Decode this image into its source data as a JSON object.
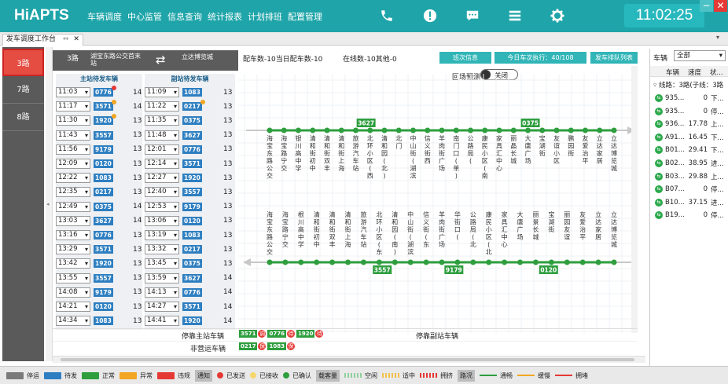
{
  "header": {
    "logo": "HiAPTS",
    "menu": [
      "车辆调度",
      "中心监管",
      "信息查询",
      "统计报表",
      "计划排班",
      "配置管理"
    ],
    "clock": "11:02:25"
  },
  "tabs": [
    {
      "label": "发车调度工作台"
    }
  ],
  "routes": [
    {
      "label": "3路",
      "selected": true
    },
    {
      "label": "7路"
    },
    {
      "label": "8路"
    }
  ],
  "route_header": {
    "name": "3路",
    "from": "湖宝东路公交首末站",
    "to": "立达博览城"
  },
  "terminals": {
    "main_title": "主站待发车辆",
    "sub_title": "副站待发车辆",
    "main_rows": [
      {
        "time": "11:03",
        "bus": "0776",
        "count": "14",
        "dot": "red"
      },
      {
        "time": "11:17",
        "bus": "3571",
        "count": "14",
        "dot": "orange"
      },
      {
        "time": "11:30",
        "bus": "1920",
        "count": "13",
        "dot": "orange"
      },
      {
        "time": "11:43",
        "bus": "3557",
        "count": "13"
      },
      {
        "time": "11:56",
        "bus": "9179",
        "count": "13"
      },
      {
        "time": "12:09",
        "bus": "0120",
        "count": "13"
      },
      {
        "time": "12:22",
        "bus": "1083",
        "count": "13"
      },
      {
        "time": "12:35",
        "bus": "0217",
        "count": "13"
      },
      {
        "time": "12:49",
        "bus": "0375",
        "count": "14"
      },
      {
        "time": "13:03",
        "bus": "3627",
        "count": "14"
      },
      {
        "time": "13:16",
        "bus": "0776",
        "count": "13"
      },
      {
        "time": "13:29",
        "bus": "3571",
        "count": "13"
      },
      {
        "time": "13:42",
        "bus": "1920",
        "count": "13"
      },
      {
        "time": "13:55",
        "bus": "3557",
        "count": "13"
      },
      {
        "time": "14:08",
        "bus": "9179",
        "count": "13"
      },
      {
        "time": "14:21",
        "bus": "0120",
        "count": "13"
      },
      {
        "time": "14:34",
        "bus": "1083",
        "count": "13"
      }
    ],
    "sub_rows": [
      {
        "time": "11:09",
        "bus": "1083",
        "count": "13"
      },
      {
        "time": "11:22",
        "bus": "0217",
        "count": "13",
        "dot": "orange"
      },
      {
        "time": "11:35",
        "bus": "0375",
        "count": "13"
      },
      {
        "time": "11:48",
        "bus": "3627",
        "count": "13"
      },
      {
        "time": "12:01",
        "bus": "0776",
        "count": "13"
      },
      {
        "time": "12:14",
        "bus": "3571",
        "count": "13"
      },
      {
        "time": "12:27",
        "bus": "1920",
        "count": "13"
      },
      {
        "time": "12:40",
        "bus": "3557",
        "count": "13"
      },
      {
        "time": "12:53",
        "bus": "9179",
        "count": "13"
      },
      {
        "time": "13:06",
        "bus": "0120",
        "count": "13"
      },
      {
        "time": "13:19",
        "bus": "1083",
        "count": "13"
      },
      {
        "time": "13:32",
        "bus": "0217",
        "count": "13"
      },
      {
        "time": "13:45",
        "bus": "0375",
        "count": "13"
      },
      {
        "time": "13:59",
        "bus": "3627",
        "count": "14"
      },
      {
        "time": "14:13",
        "bus": "0776",
        "count": "14"
      },
      {
        "time": "14:27",
        "bus": "3571",
        "count": "14"
      },
      {
        "time": "14:41",
        "bus": "1920",
        "count": "14"
      }
    ]
  },
  "center": {
    "stats1": "配车数-10当日配车数-10",
    "stats2": "在线数-10其他-0",
    "btn_shift": "班次信息",
    "btn_today": "今日车次执行：40/108",
    "btn_queue": "发车排队列表",
    "return_label": "回场预测",
    "toggle_label": "关闭",
    "stations_top": [
      "海宝东路公交",
      "海宝路宁交",
      "银川高中学",
      "清和街初中",
      "清和街双丰",
      "清和街上海",
      "旅游汽车站",
      "北环小区(西)",
      "清和园(北)",
      "北门",
      "中山街(湖滨)",
      "信义街西",
      "羊肉街广场",
      "南门口(单)",
      "公路局(",
      "康民小区(南)",
      "家具汇中心",
      "丽晶长城",
      "大唐广场",
      "宝湖街",
      "友谊小区",
      "鹏园街",
      "友爱治平",
      "立达家居",
      "立达博览城"
    ],
    "stations_bottom": [
      "海宝东路公交",
      "海宝路宁交",
      "根川高中学",
      "清和街初中",
      "清和街双丰",
      "清和街上海",
      "旅游汽车站",
      "北环小区(东)",
      "清和园(南)",
      "中山街(湖滨)",
      "信义街(东",
      "羊肉街广场",
      "华街口(",
      "公路局(北",
      "康民小区(北",
      "家具汇中心",
      "大唐广场",
      "丽景长城",
      "宝湖街",
      "丽园友谊",
      "友爱治平",
      "立达家居",
      "立达博览城"
    ],
    "bus_top": [
      {
        "id": "3627",
        "pos": 0.28
      },
      {
        "id": "0375",
        "pos": 0.757
      }
    ],
    "bus_bottom": [
      {
        "id": "3557",
        "pos": 0.327
      },
      {
        "id": "9179",
        "pos": 0.535
      },
      {
        "id": "0120",
        "pos": 0.81
      }
    ]
  },
  "bottom": {
    "main_parked_label": "停靠主站车辆",
    "sub_parked_label": "停靠副站车辆",
    "non_op_label": "非营运车辆",
    "main_parked": [
      {
        "bus": "3571",
        "tag": "调"
      },
      {
        "bus": "0776",
        "tag": "待"
      },
      {
        "bus": "1920",
        "tag": "待"
      }
    ],
    "non_op": [
      {
        "bus": "0217",
        "tag": "保"
      },
      {
        "bus": "1083",
        "tag": "保"
      }
    ]
  },
  "right_panel": {
    "label": "车辆",
    "filter": "全部",
    "col_bus": "车辆",
    "col_speed": "速度",
    "col_status": "状...",
    "group": "线路：3路(子线：3路",
    "rows": [
      {
        "bus": "935...",
        "speed": "0",
        "status": "下..."
      },
      {
        "bus": "935...",
        "speed": "0",
        "status": "停..."
      },
      {
        "bus": "936...",
        "speed": "17.78",
        "status": "上..."
      },
      {
        "bus": "A91...",
        "speed": "16.45",
        "status": "下..."
      },
      {
        "bus": "B01...",
        "speed": "29.41",
        "status": "下..."
      },
      {
        "bus": "B02...",
        "speed": "38.95",
        "status": "进..."
      },
      {
        "bus": "B03...",
        "speed": "29.88",
        "status": "上..."
      },
      {
        "bus": "B07...",
        "speed": "0",
        "status": "停..."
      },
      {
        "bus": "B10...",
        "speed": "37.15",
        "status": "进..."
      },
      {
        "bus": "B19...",
        "speed": "0",
        "status": "停..."
      }
    ]
  },
  "legend": [
    {
      "label": "停运",
      "color": "#7a7a7a"
    },
    {
      "label": "待发",
      "color": "#2e7fc1"
    },
    {
      "label": "正常",
      "color": "#2e9e3e"
    },
    {
      "label": "异常",
      "color": "#f2a623"
    },
    {
      "label": "违规",
      "color": "#e53935"
    }
  ],
  "legend_notice": "通知",
  "legend_notice_items": [
    {
      "label": "已发送",
      "color": "#e53935"
    },
    {
      "label": "已接收",
      "color": "#f5d76e"
    },
    {
      "label": "已确认",
      "color": "#2e9e3e"
    }
  ],
  "legend_load": "载客量",
  "legend_load_items": [
    {
      "label": "空闲",
      "color": "#8fd19e"
    },
    {
      "label": "适中",
      "color": "#f5c04a"
    },
    {
      "label": "拥挤",
      "color": "#e53935"
    }
  ],
  "legend_road": "路况",
  "legend_road_items": [
    {
      "label": "通畅",
      "color": "#2e9e3e"
    },
    {
      "label": "缓慢",
      "color": "#f2a623"
    },
    {
      "label": "拥堵",
      "color": "#e53935"
    }
  ]
}
